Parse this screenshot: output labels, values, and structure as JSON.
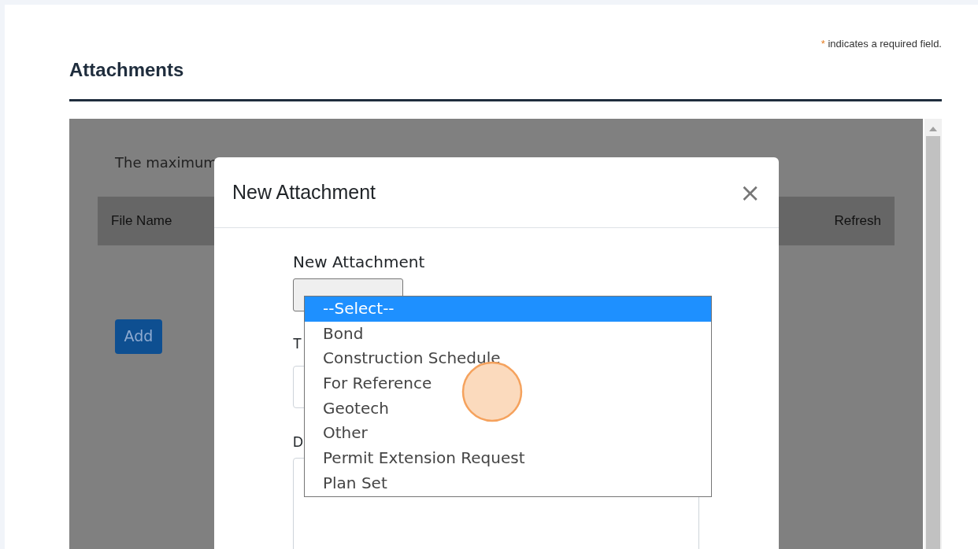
{
  "required_note": {
    "mark": "*",
    "text": "indicates a required field."
  },
  "section_title": "Attachments",
  "panel": {
    "notice": "The maximum",
    "table_columns": [
      "File Name",
      "Refresh"
    ],
    "add_button": "Add"
  },
  "modal": {
    "title": "New Attachment",
    "close": "×",
    "file_label": "New Attachment",
    "type_label": "T",
    "description_label": "D"
  },
  "dropdown": {
    "options": [
      {
        "label": "--Select--",
        "selected": true
      },
      {
        "label": "Bond",
        "selected": false
      },
      {
        "label": "Construction Schedule",
        "selected": false
      },
      {
        "label": "For Reference",
        "selected": false
      },
      {
        "label": "Geotech",
        "selected": false
      },
      {
        "label": "Other",
        "selected": false
      },
      {
        "label": "Permit Extension Request",
        "selected": false
      },
      {
        "label": "Plan Set",
        "selected": false
      }
    ]
  }
}
